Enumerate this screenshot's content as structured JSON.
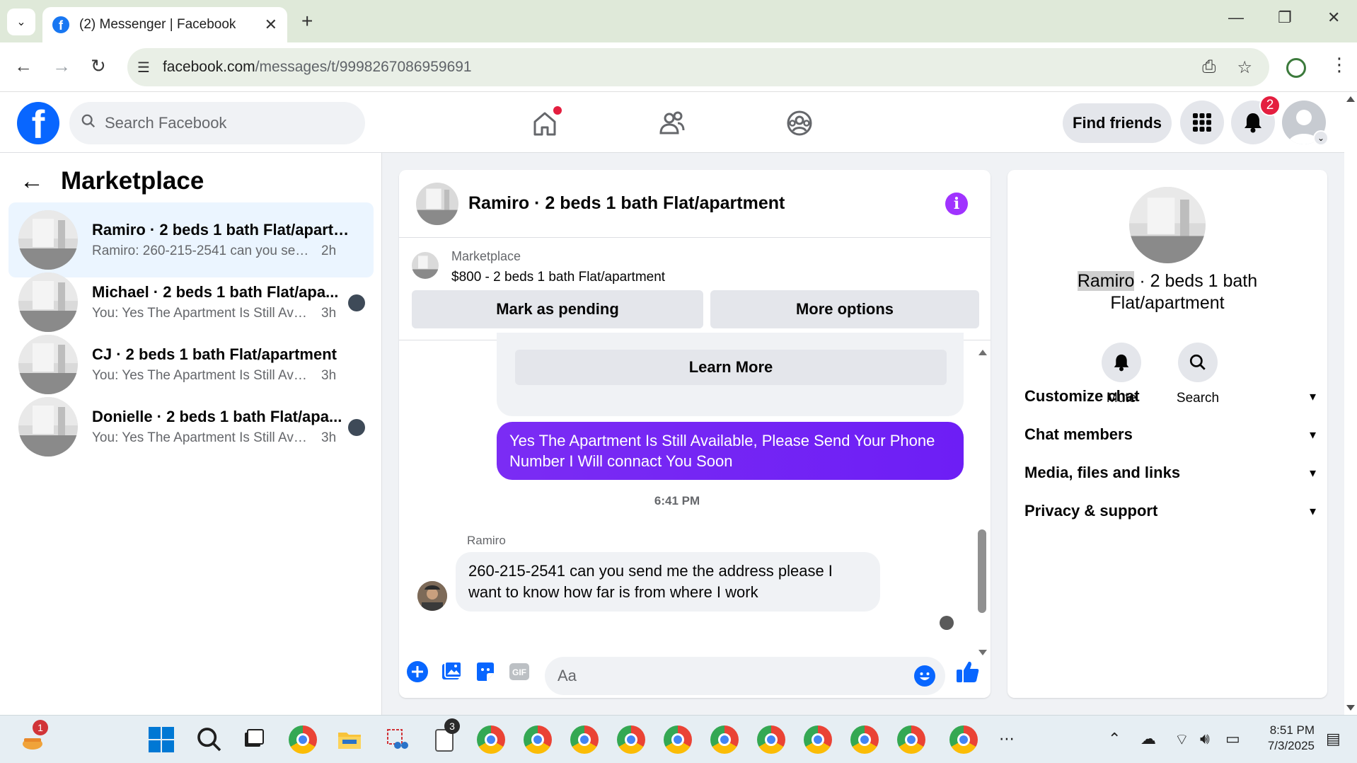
{
  "browser": {
    "tab_title": "(2) Messenger | Facebook",
    "url_host": "facebook.com",
    "url_path": "/messages/t/9998267086959691"
  },
  "fb_header": {
    "search_placeholder": "Search Facebook",
    "find_friends": "Find friends",
    "notification_count": "2"
  },
  "sidebar": {
    "title": "Marketplace",
    "threads": [
      {
        "name": "Ramiro · 2 beds 1 bath Flat/apartm...",
        "snippet": "Ramiro: 260-215-2541 can you send ...",
        "time": "2h",
        "active": true
      },
      {
        "name": "Michael · 2 beds 1 bath Flat/apa...",
        "snippet": "You: Yes The Apartment Is Still Avail...",
        "time": "3h"
      },
      {
        "name": "CJ · 2 beds 1 bath Flat/apartment",
        "snippet": "You: Yes The Apartment Is Still Availab...",
        "time": "3h"
      },
      {
        "name": "Donielle · 2 beds 1 bath Flat/apa...",
        "snippet": "You: Yes The Apartment Is Still Avail...",
        "time": "3h"
      }
    ]
  },
  "chat": {
    "title": "Ramiro · 2 beds 1 bath Flat/apartment",
    "listing_label": "Marketplace",
    "listing_value": "$800 - 2 beds 1 bath Flat/apartment",
    "mark_pending": "Mark as pending",
    "more_options": "More options",
    "learn_more": "Learn More",
    "my_message": "Yes The Apartment Is Still Available, Please Send Your Phone Number I Will connact You Soon",
    "timestamp": "6:41 PM",
    "sender": "Ramiro",
    "their_message": "260-215-2541  can you send me the address please  I want to know how far is from where I work",
    "input_placeholder": "Aa"
  },
  "details": {
    "name_highlight": "Ramiro",
    "name_rest": " · 2 beds 1 bath Flat/apartment",
    "mute": "Mute",
    "search": "Search",
    "sections": [
      "Customize chat",
      "Chat members",
      "Media, files and links",
      "Privacy & support"
    ]
  },
  "taskbar": {
    "time": "8:51 PM",
    "date": "7/3/2025",
    "widget_badge": "1",
    "notepad_badge": "3"
  },
  "colors": {
    "fb_blue": "#0866ff",
    "my_bubble": "#7b2cf4",
    "info_purple": "#a033ff",
    "badge_red": "#e41e3f"
  }
}
